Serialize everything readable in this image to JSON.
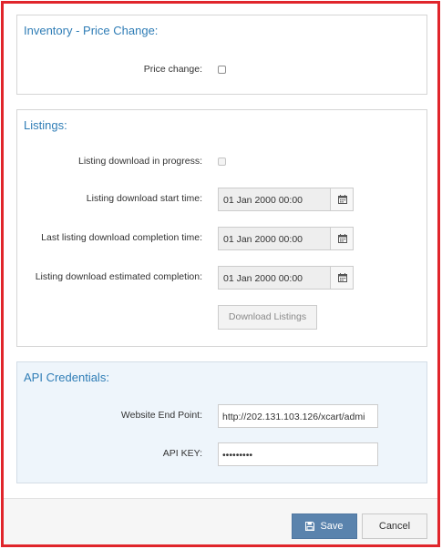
{
  "inventory_section": {
    "title": "Inventory - Price Change:",
    "price_change_label": "Price change:",
    "price_change_checked": false
  },
  "listings_section": {
    "title": "Listings:",
    "in_progress_label": "Listing download in progress:",
    "in_progress_checked": false,
    "start_time_label": "Listing download start time:",
    "start_time_value": "01 Jan 2000 00:00",
    "last_completion_label": "Last listing download completion time:",
    "last_completion_value": "01 Jan 2000 00:00",
    "estimated_completion_label": "Listing download estimated completion:",
    "estimated_completion_value": "01 Jan 2000 00:00",
    "download_button_label": "Download Listings",
    "calendar_icon": "calendar-icon"
  },
  "api_section": {
    "title": "API Credentials:",
    "endpoint_label": "Website End Point:",
    "endpoint_value": "http://202.131.103.126/xcart/admi",
    "api_key_label": "API KEY:",
    "api_key_value": "•••••••••"
  },
  "footer": {
    "save_label": "Save",
    "save_icon": "floppy-disk-icon",
    "cancel_label": "Cancel"
  },
  "colors": {
    "frame_border": "#e0252b",
    "section_title": "#2f7db6",
    "save_button": "#5a83ad",
    "api_section_bg": "#eef5fb"
  }
}
